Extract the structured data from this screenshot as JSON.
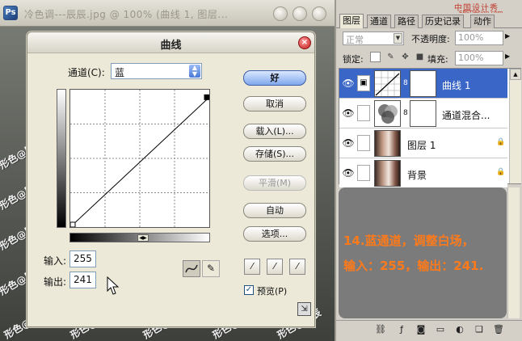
{
  "document": {
    "title": "冷色调---辰辰.jpg @ 100% (曲线 1, 图层...",
    "watermark": "形色@辰辰"
  },
  "curves_dialog": {
    "title": "曲线",
    "channel_label": "通道(C):",
    "channel_value": "蓝",
    "input_label": "输入:",
    "input_value": "255",
    "output_label": "输出:",
    "output_value": "241",
    "buttons": {
      "ok": "好",
      "cancel": "取消",
      "load": "载入(L)...",
      "save": "存储(S)...",
      "smooth": "平滑(M)",
      "auto": "自动",
      "options": "选项..."
    },
    "preview_label": "预览(P)",
    "preview_checked": true,
    "curve_points": [
      [
        0,
        0
      ],
      [
        255,
        241
      ]
    ]
  },
  "layers_panel": {
    "tabs": [
      "图层",
      "通道",
      "路径",
      "历史记录",
      "动作"
    ],
    "logo_text": "中国设计秀",
    "logo_url": "EPSDesign.com",
    "blend_mode": "正常",
    "opacity_label": "不透明度:",
    "opacity_value": "100%",
    "lock_label": "锁定:",
    "fill_label": "填充:",
    "fill_value": "100%",
    "layers": [
      {
        "name": "曲线 1",
        "selected": true
      },
      {
        "name": "通道混合...",
        "selected": false
      },
      {
        "name": "图层 1",
        "selected": false
      },
      {
        "name": "背景",
        "selected": false
      }
    ],
    "note_line1": "14.蓝通道，调整白场，",
    "note_line2": "输入：255，输出：241."
  },
  "colors": {
    "note_text": "#ff7a1a",
    "selection": "#3a66c8"
  }
}
